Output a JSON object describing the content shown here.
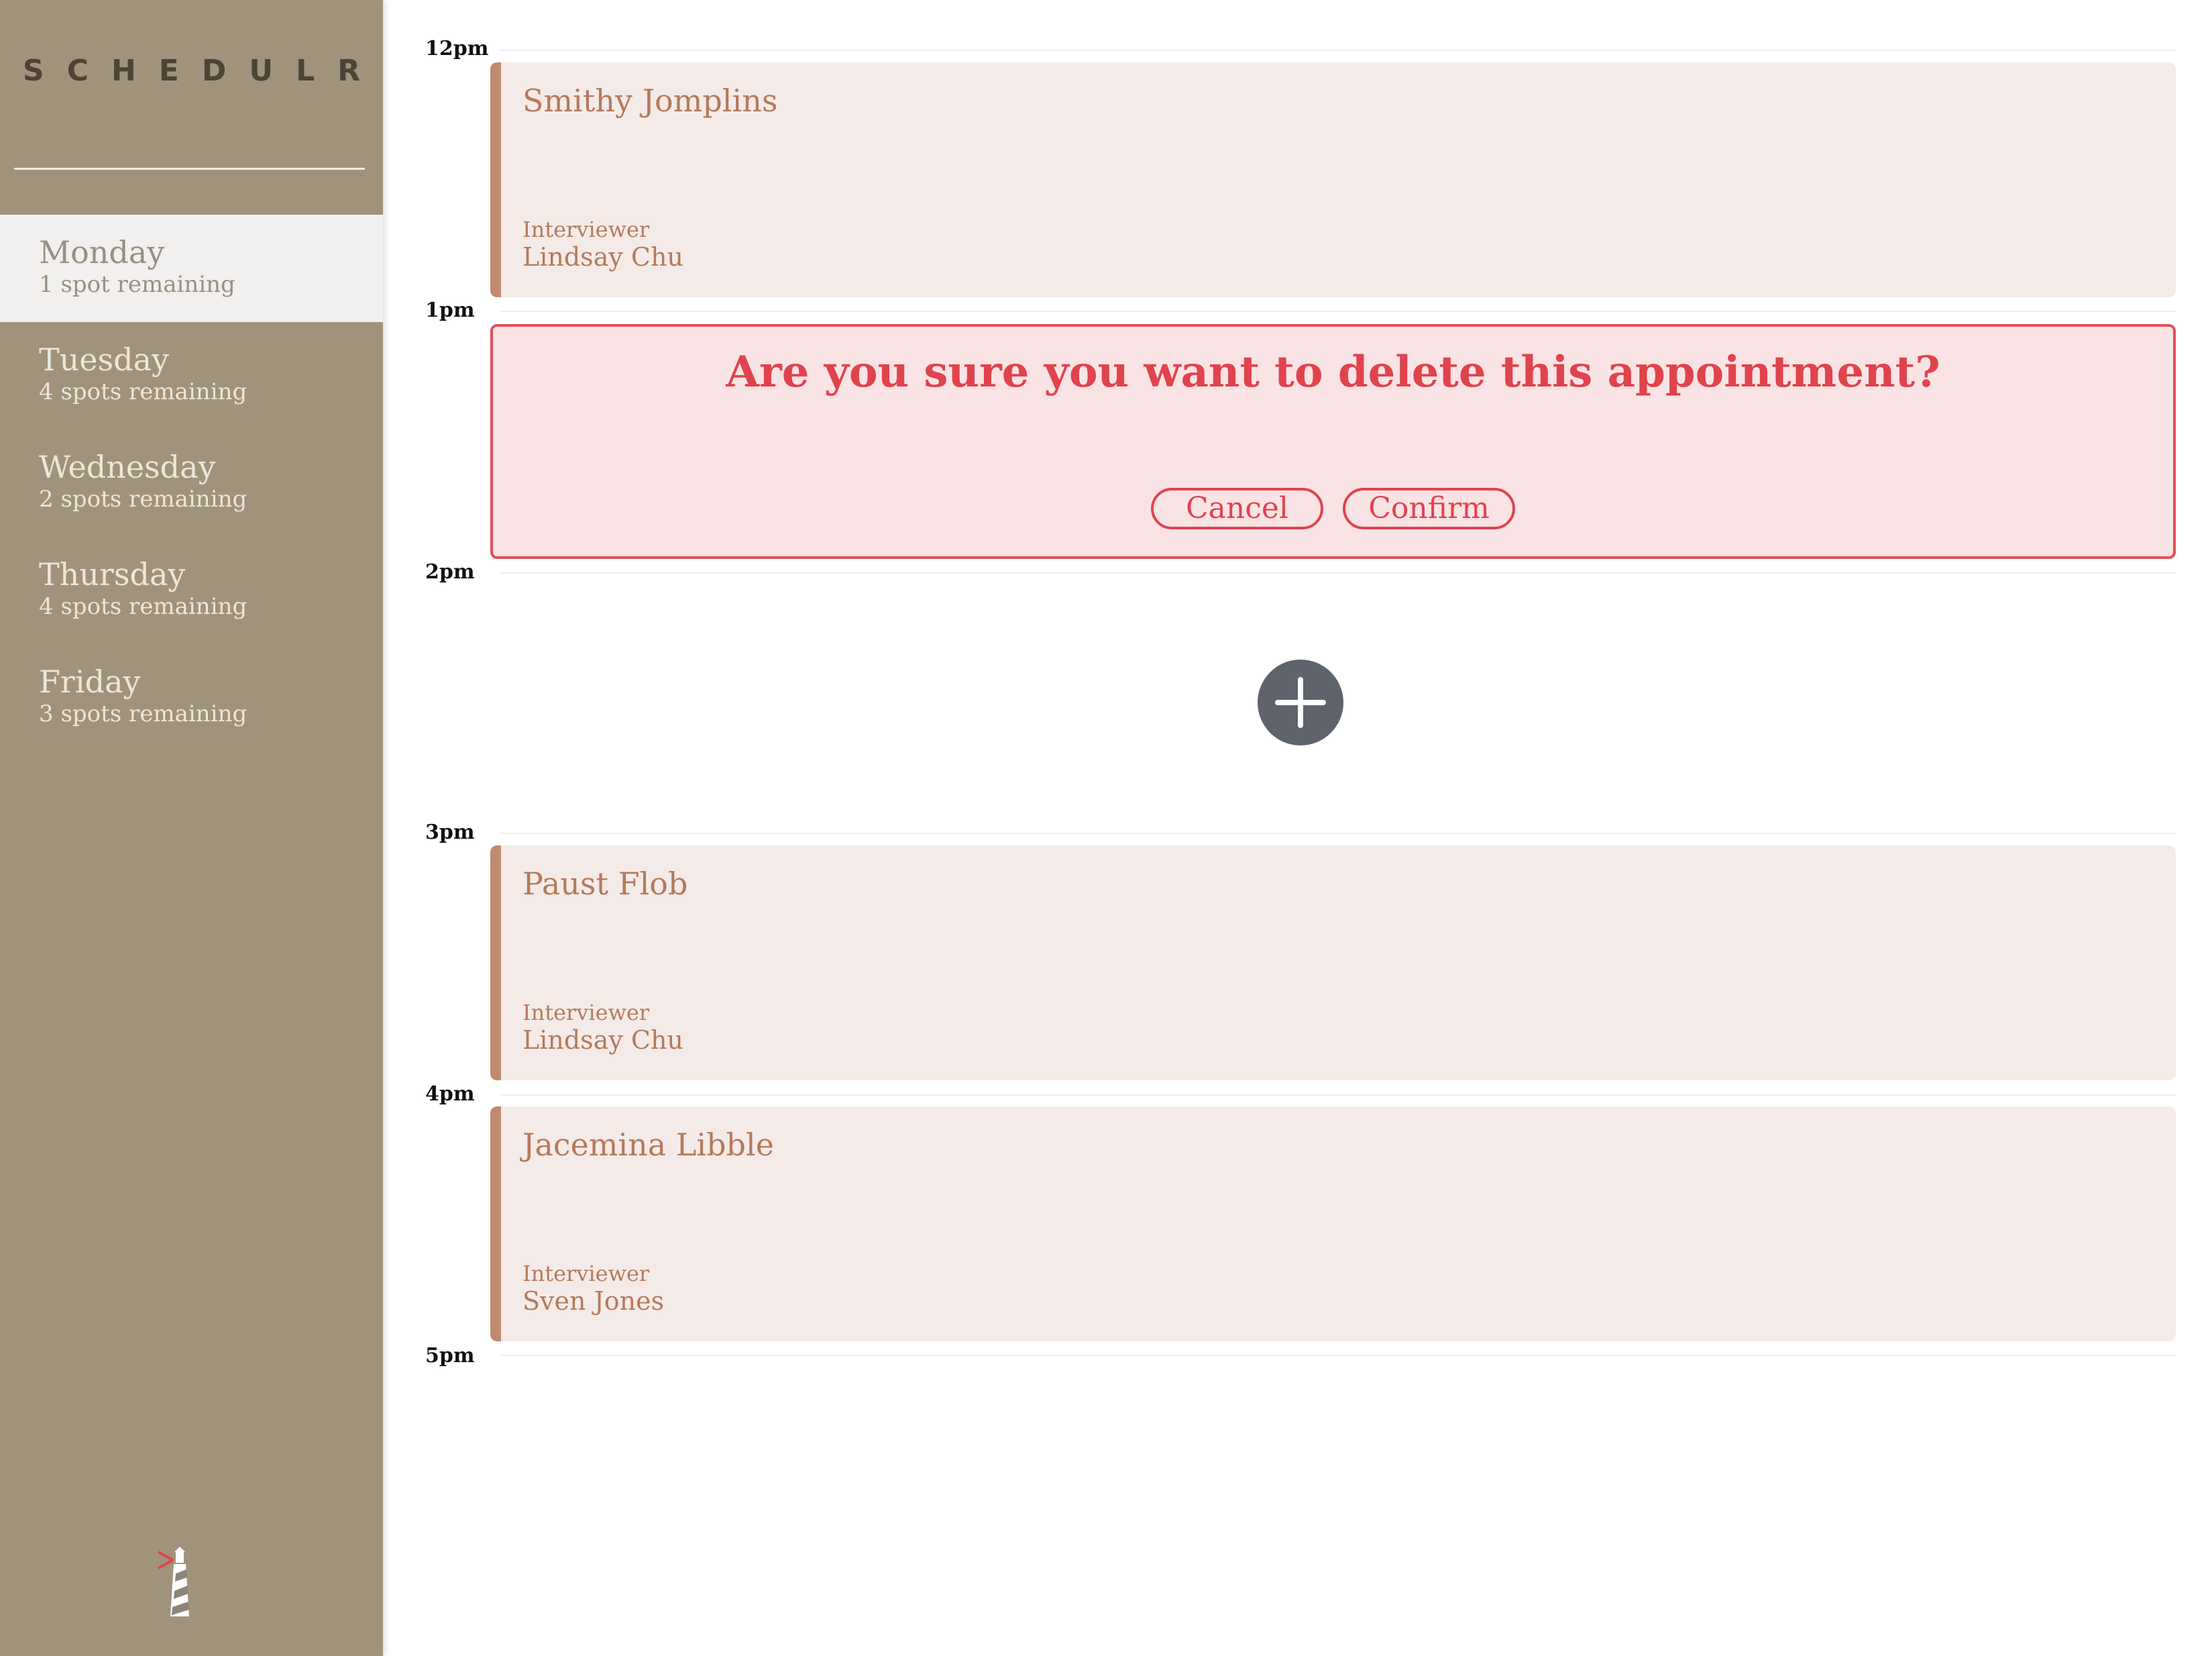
{
  "app": {
    "logo": "SCHEDULR"
  },
  "sidebar": {
    "days": [
      {
        "name": "Monday",
        "spots": "1 spot remaining",
        "selected": true
      },
      {
        "name": "Tuesday",
        "spots": "4 spots remaining",
        "selected": false
      },
      {
        "name": "Wednesday",
        "spots": "2 spots remaining",
        "selected": false
      },
      {
        "name": "Thursday",
        "spots": "4 spots remaining",
        "selected": false
      },
      {
        "name": "Friday",
        "spots": "3 spots remaining",
        "selected": false
      }
    ],
    "footer_icon": "lighthouse-icon"
  },
  "schedule": {
    "hours": [
      "12pm",
      "1pm",
      "2pm",
      "3pm",
      "4pm",
      "5pm"
    ],
    "appointments": [
      {
        "student": "Smithy Jomplins",
        "interviewer_label": "Interviewer",
        "interviewer": "Lindsay Chu"
      },
      {
        "student": "Paust Flob",
        "interviewer_label": "Interviewer",
        "interviewer": "Lindsay Chu"
      },
      {
        "student": "Jacemina Libble",
        "interviewer_label": "Interviewer",
        "interviewer": "Sven Jones"
      }
    ],
    "confirm": {
      "message": "Are you sure you want to delete this appointment?",
      "cancel_label": "Cancel",
      "confirm_label": "Confirm"
    },
    "add_icon": "plus-icon"
  },
  "colors": {
    "sidebar_bg": "#a1937b",
    "selected_day_bg": "#f1f0ef",
    "appointment_bg": "#f4ebe8",
    "appointment_accent": "#c08a6f",
    "danger": "#e0434e",
    "add_button": "#5f636c"
  }
}
